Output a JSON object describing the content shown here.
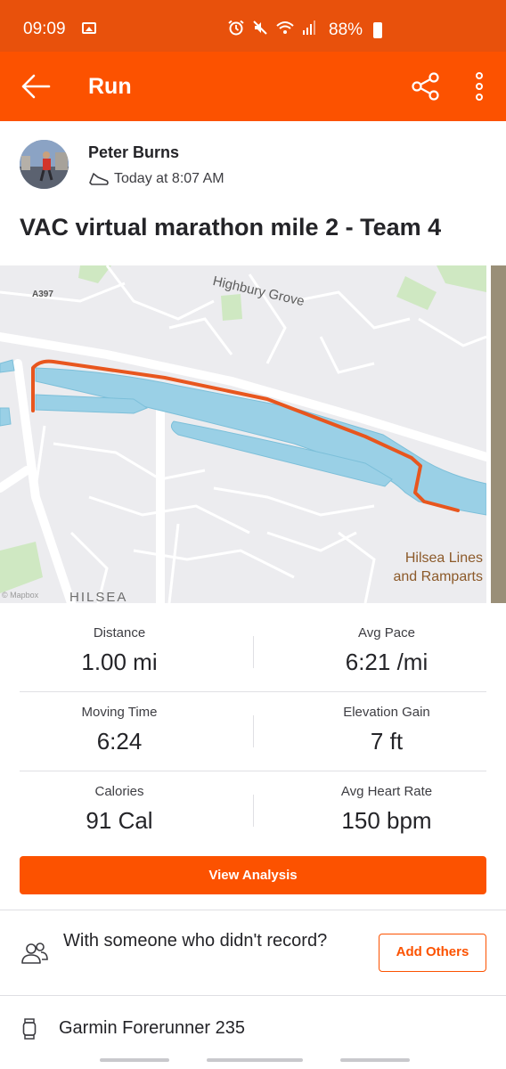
{
  "status_bar": {
    "time": "09:09",
    "battery": "88%",
    "icons": [
      "gallery-icon",
      "alarm-icon",
      "mute-icon",
      "wifi-icon",
      "signal-icon",
      "battery-icon"
    ]
  },
  "app_bar": {
    "title": "Run",
    "color": "#fc5200"
  },
  "athlete": {
    "name": "Peter Burns",
    "time": "Today at 8:07 AM"
  },
  "activity": {
    "title": "VAC virtual marathon mile 2 - Team 4"
  },
  "map": {
    "labels": {
      "road_a397": "A397",
      "highbury_grove": "Highbury Grove",
      "hilsea_lines_1": "Hilsea Lines",
      "hilsea_lines_2": "and Ramparts",
      "hilsea": "HILSEA",
      "attribution": "© Mapbox"
    },
    "route_color": "#e8561e"
  },
  "stats": [
    {
      "label": "Distance",
      "value": "1.00 mi"
    },
    {
      "label": "Avg Pace",
      "value": "6:21 /mi"
    },
    {
      "label": "Moving Time",
      "value": "6:24"
    },
    {
      "label": "Elevation Gain",
      "value": "7 ft"
    },
    {
      "label": "Calories",
      "value": "91 Cal"
    },
    {
      "label": "Avg Heart Rate",
      "value": "150 bpm"
    }
  ],
  "actions": {
    "view_analysis": "View Analysis",
    "with_someone": "With someone who didn't record?",
    "add_others": "Add Others"
  },
  "device": {
    "name": "Garmin Forerunner 235"
  }
}
